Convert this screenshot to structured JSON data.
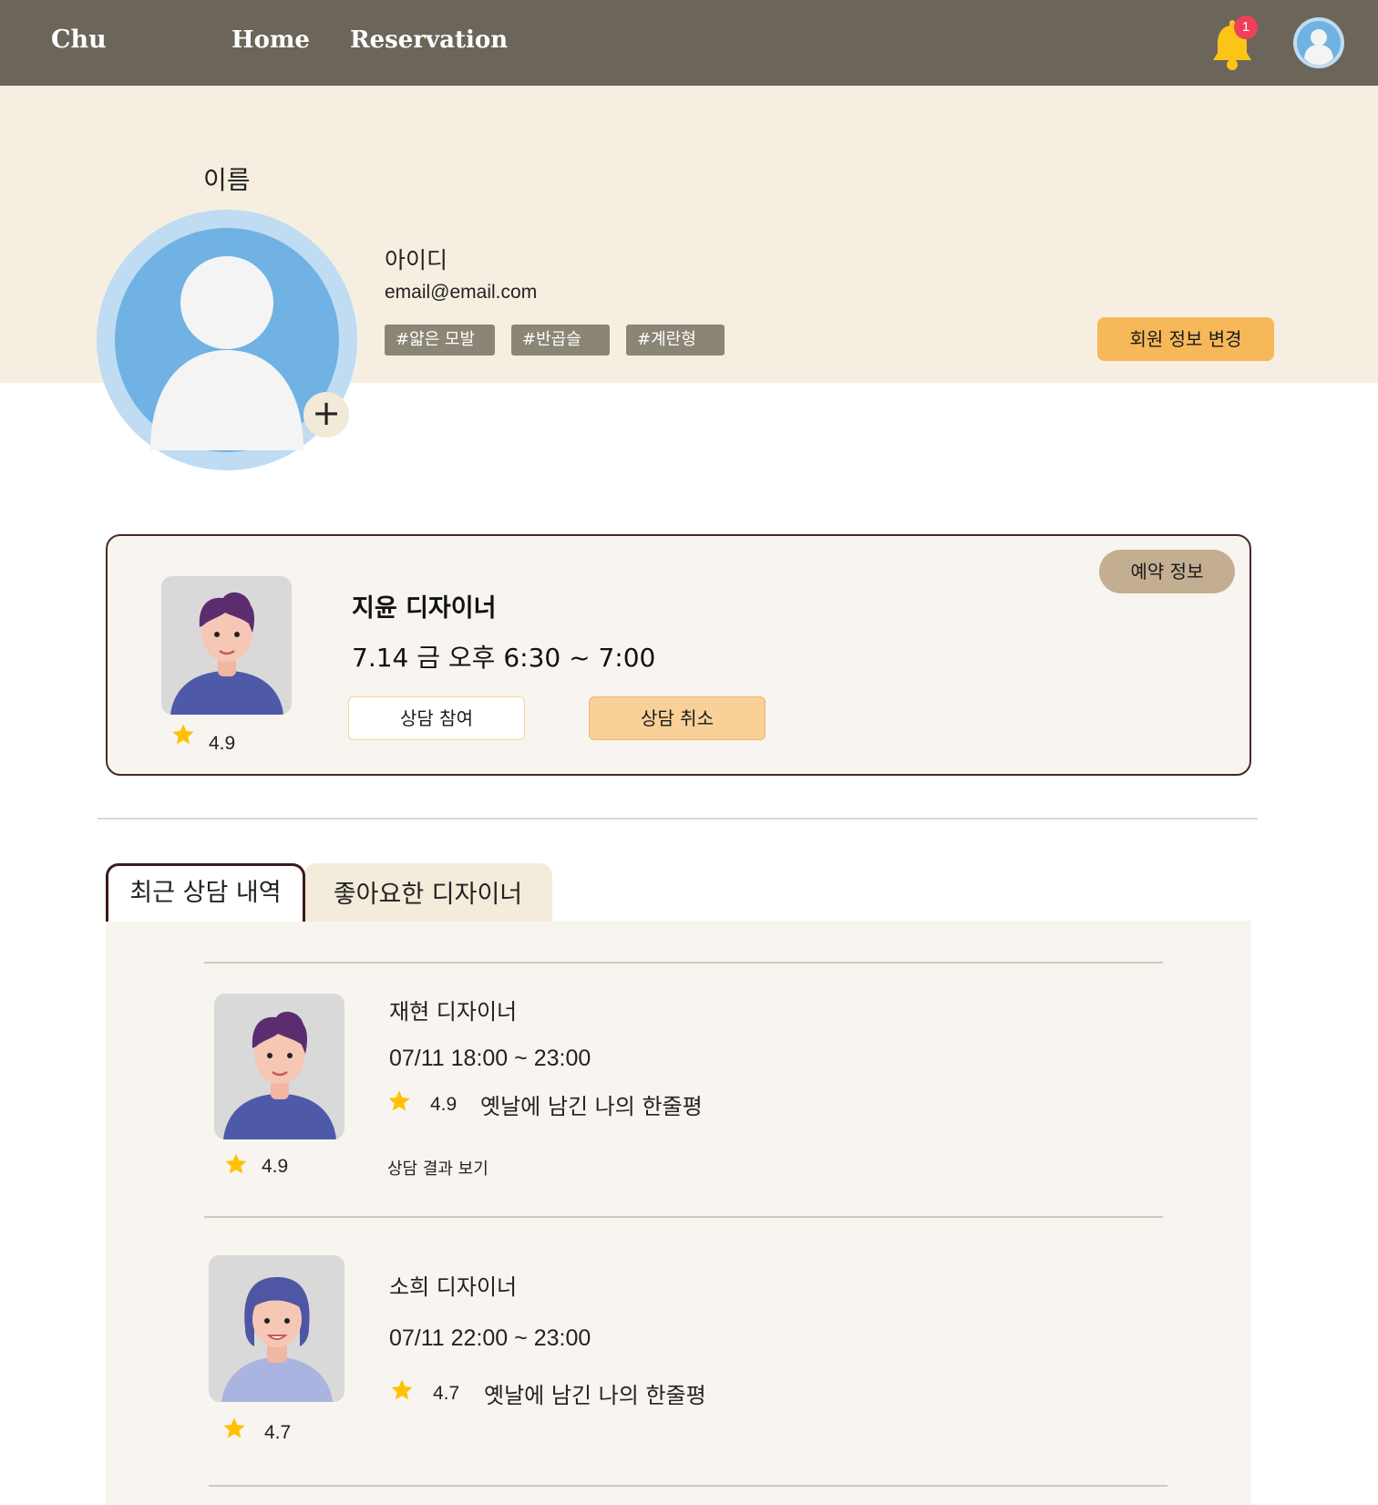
{
  "nav": {
    "brand": "Chu",
    "links": [
      "Home",
      "Reservation"
    ],
    "notification_count": "1",
    "icons": [
      "bell-icon",
      "user-avatar-icon"
    ]
  },
  "profile": {
    "name_label": "이름",
    "id_label": "아이디",
    "email": "email@email.com",
    "tags": [
      "#얇은 모발",
      "#반곱슬",
      "#계란형"
    ],
    "edit_button": "회원 정보 변경",
    "add_photo_symbol": "+"
  },
  "reservation": {
    "badge": "예약 정보",
    "designer": "지윤 디자이너",
    "time": "7.14 금 오후 6:30 ~ 7:00",
    "rating": "4.9",
    "join_button": "상담 참여",
    "cancel_button": "상담 취소"
  },
  "tabs": [
    "최근 상담 내역",
    "좋아요한 디자이너"
  ],
  "history": [
    {
      "designer": "재현 디자이너",
      "time": "07/11 18:00 ~ 23:00",
      "rating": "4.9",
      "review": "옛날에 남긴 나의 한줄평",
      "photo_rating": "4.9",
      "result_link": "상담 결과 보기"
    },
    {
      "designer": "소희 디자이너",
      "time": "07/11 22:00 ~ 23:00",
      "rating": "4.7",
      "review": "옛날에 남긴 나의 한줄평",
      "photo_rating": "4.7"
    }
  ],
  "colors": {
    "nav_bg": "#6b655a",
    "profile_bg": "#f6efe1",
    "accent_orange": "#f7b85a",
    "tag_bg": "#8b8575",
    "star": "#ffc107",
    "card_border": "#4a2727"
  }
}
